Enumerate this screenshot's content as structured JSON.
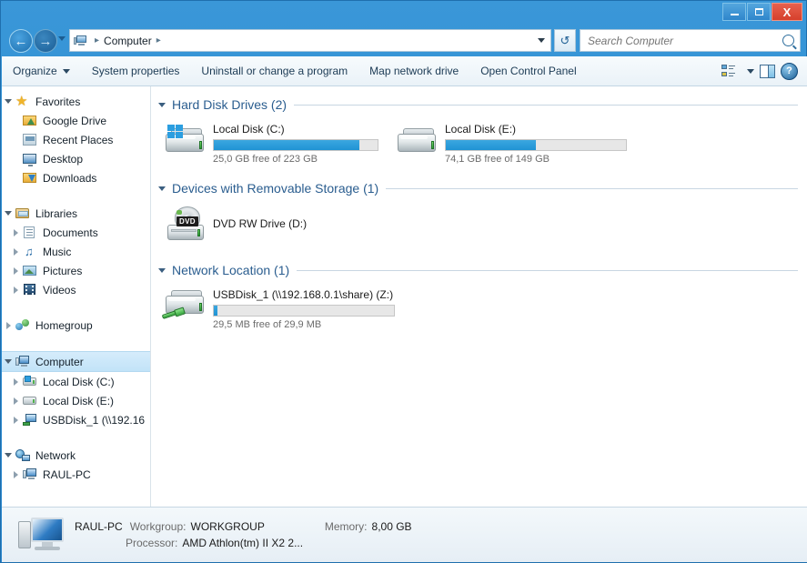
{
  "window": {
    "minimize_label": "Minimize",
    "maximize_label": "Maximize",
    "close_label": "X"
  },
  "address_bar": {
    "back_label": "←",
    "forward_label": "→",
    "crumb_root": "Computer",
    "separator": "▸",
    "refresh_label": "↺"
  },
  "search": {
    "placeholder": "Search Computer",
    "value": ""
  },
  "toolbar": {
    "organize": "Organize",
    "system_properties": "System properties",
    "uninstall": "Uninstall or change a program",
    "map_network_drive": "Map network drive",
    "open_control_panel": "Open Control Panel"
  },
  "sidebar": {
    "groups": [
      {
        "header": "Favorites",
        "items": [
          {
            "label": "Google Drive"
          },
          {
            "label": "Recent Places"
          },
          {
            "label": "Desktop"
          },
          {
            "label": "Downloads"
          }
        ]
      },
      {
        "header": "Libraries",
        "items": [
          {
            "label": "Documents"
          },
          {
            "label": "Music"
          },
          {
            "label": "Pictures"
          },
          {
            "label": "Videos"
          }
        ]
      },
      {
        "header": "Homegroup",
        "items": []
      },
      {
        "header": "Computer",
        "items": [
          {
            "label": "Local Disk (C:)"
          },
          {
            "label": "Local Disk (E:)"
          },
          {
            "label": "USBDisk_1 (\\\\192.16"
          }
        ]
      },
      {
        "header": "Network",
        "items": [
          {
            "label": "RAUL-PC"
          }
        ]
      }
    ]
  },
  "main": {
    "sections": [
      {
        "title": "Hard Disk Drives (2)",
        "drives": [
          {
            "name": "Local Disk (C:)",
            "free_text": "25,0 GB free of 223 GB",
            "used_percent": 89,
            "icon": "hard-drive-windows-icon",
            "has_bar": true
          },
          {
            "name": "Local Disk (E:)",
            "free_text": "74,1 GB free of 149 GB",
            "used_percent": 50,
            "icon": "hard-drive-icon",
            "has_bar": true
          }
        ]
      },
      {
        "title": "Devices with Removable Storage (1)",
        "drives": [
          {
            "name": "DVD RW Drive (D:)",
            "free_text": "",
            "used_percent": 0,
            "icon": "dvd-drive-icon",
            "has_bar": false,
            "badge": "DVD"
          }
        ]
      },
      {
        "title": "Network Location (1)",
        "drives": [
          {
            "name": "USBDisk_1 (\\\\192.168.0.1\\share) (Z:)",
            "free_text": "29,5 MB free of 29,9 MB",
            "used_percent": 2,
            "icon": "network-drive-icon",
            "has_bar": true
          }
        ]
      }
    ]
  },
  "status": {
    "computer_name": "RAUL-PC",
    "workgroup_label": "Workgroup:",
    "workgroup_value": "WORKGROUP",
    "memory_label": "Memory:",
    "memory_value": "8,00 GB",
    "processor_label": "Processor:",
    "processor_value": "AMD Athlon(tm) II X2 2..."
  },
  "colors": {
    "accent_blue": "#2a86cc",
    "bar_fill": "#1f93d4",
    "section_title": "#2a5d8f",
    "selection": "#c2e3f8"
  }
}
